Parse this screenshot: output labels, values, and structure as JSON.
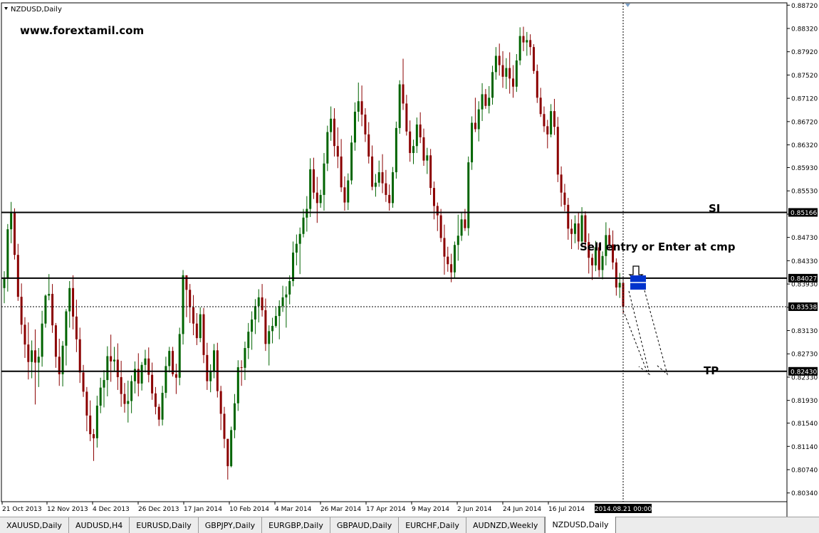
{
  "window": {
    "menu_icon": "dropdown-triangle-icon",
    "title": "NZDUSD,Daily"
  },
  "annotations": {
    "watermark": "www.forextamil.com",
    "sl_label": "SI",
    "sell_label": "Sell entry or Enter at cmp",
    "tp_label": "TP"
  },
  "chart_data": {
    "type": "candlestick",
    "symbol": "NZDUSD",
    "timeframe": "Daily",
    "ylim": [
      0.8019,
      0.8876
    ],
    "y_ticks": [
      0.8872,
      0.8832,
      0.8792,
      0.8752,
      0.8712,
      0.8672,
      0.8632,
      0.8593,
      0.8553,
      0.8513,
      0.8473,
      0.8433,
      0.8393,
      0.8353,
      0.8313,
      0.8273,
      0.8233,
      0.8193,
      0.8154,
      0.8114,
      0.8074,
      0.8034
    ],
    "y_tick_labels": [
      "0.88720",
      "0.88320",
      "0.87920",
      "0.87520",
      "0.87120",
      "0.86720",
      "0.86320",
      "0.85930",
      "0.85530",
      "0.85130",
      "0.84730",
      "0.84330",
      "0.83930",
      "0.83530",
      "0.83130",
      "0.82730",
      "0.82330",
      "0.81930",
      "0.81540",
      "0.81140",
      "0.80740",
      "0.80340"
    ],
    "x_labels": [
      "21 Oct 2013",
      "12 Nov 2013",
      "4 Dec 2013",
      "26 Dec 2013",
      "17 Jan 2014",
      "10 Feb 2014",
      "4 Mar 2014",
      "26 Mar 2014",
      "17 Apr 2014",
      "9 May 2014",
      "2 Jun 2014",
      "24 Jun 2014",
      "16 Jul 2014"
    ],
    "crosshair_date": "2014.08.21 00:00",
    "levels": [
      {
        "name": "stop-loss",
        "price": 0.8516,
        "label": "0.85166"
      },
      {
        "name": "entry",
        "price": 0.8403,
        "label": "0.84027"
      },
      {
        "name": "current-price",
        "price": 0.8354,
        "label": "0.83538"
      },
      {
        "name": "take-profit",
        "price": 0.8243,
        "label": "0.82430"
      }
    ],
    "colors": {
      "bull": "#006400",
      "bear": "#8b0000",
      "level": "#000000",
      "marker": "#0033cc"
    },
    "candles_ohlc": [
      [
        0.8386,
        0.8415,
        0.836,
        0.8402
      ],
      [
        0.8402,
        0.8496,
        0.838,
        0.8487
      ],
      [
        0.8487,
        0.8534,
        0.8463,
        0.8516
      ],
      [
        0.8516,
        0.8523,
        0.8435,
        0.8443
      ],
      [
        0.8443,
        0.8462,
        0.8364,
        0.8371
      ],
      [
        0.8371,
        0.8394,
        0.8307,
        0.8323
      ],
      [
        0.8323,
        0.8336,
        0.8266,
        0.8289
      ],
      [
        0.8289,
        0.8327,
        0.8229,
        0.8259
      ],
      [
        0.8259,
        0.8296,
        0.8231,
        0.8279
      ],
      [
        0.8279,
        0.8315,
        0.8186,
        0.8258
      ],
      [
        0.8258,
        0.8283,
        0.8216,
        0.8268
      ],
      [
        0.8268,
        0.8347,
        0.8251,
        0.8325
      ],
      [
        0.8325,
        0.8375,
        0.8318,
        0.8373
      ],
      [
        0.8373,
        0.841,
        0.8365,
        0.8376
      ],
      [
        0.8376,
        0.8393,
        0.8309,
        0.8322
      ],
      [
        0.8322,
        0.8326,
        0.8249,
        0.8268
      ],
      [
        0.8268,
        0.8299,
        0.8218,
        0.8238
      ],
      [
        0.8238,
        0.8295,
        0.8217,
        0.8287
      ],
      [
        0.8287,
        0.835,
        0.8253,
        0.8346
      ],
      [
        0.8346,
        0.8398,
        0.8318,
        0.8386
      ],
      [
        0.8386,
        0.8408,
        0.8315,
        0.8337
      ],
      [
        0.8337,
        0.8366,
        0.8276,
        0.8298
      ],
      [
        0.8298,
        0.8318,
        0.8223,
        0.8241
      ],
      [
        0.8241,
        0.8254,
        0.8199,
        0.8208
      ],
      [
        0.8208,
        0.8216,
        0.814,
        0.8167
      ],
      [
        0.8167,
        0.8193,
        0.8123,
        0.8135
      ],
      [
        0.8135,
        0.8144,
        0.8089,
        0.8128
      ],
      [
        0.8128,
        0.8201,
        0.8112,
        0.8184
      ],
      [
        0.8184,
        0.8232,
        0.8171,
        0.8215
      ],
      [
        0.8215,
        0.8245,
        0.8181,
        0.8228
      ],
      [
        0.8228,
        0.8286,
        0.82,
        0.8269
      ],
      [
        0.8269,
        0.8306,
        0.8225,
        0.826
      ],
      [
        0.826,
        0.8285,
        0.8242,
        0.8263
      ],
      [
        0.8263,
        0.8291,
        0.8211,
        0.8233
      ],
      [
        0.8233,
        0.8261,
        0.8182,
        0.8204
      ],
      [
        0.8204,
        0.8223,
        0.8172,
        0.8187
      ],
      [
        0.8187,
        0.8227,
        0.8155,
        0.8192
      ],
      [
        0.8192,
        0.8236,
        0.8171,
        0.8226
      ],
      [
        0.8226,
        0.826,
        0.8205,
        0.8247
      ],
      [
        0.8247,
        0.8274,
        0.82,
        0.8222
      ],
      [
        0.8222,
        0.8259,
        0.821,
        0.8254
      ],
      [
        0.8254,
        0.828,
        0.8241,
        0.8265
      ],
      [
        0.8265,
        0.8284,
        0.8224,
        0.8237
      ],
      [
        0.8237,
        0.8258,
        0.8194,
        0.8205
      ],
      [
        0.8205,
        0.8216,
        0.8169,
        0.8182
      ],
      [
        0.8182,
        0.8187,
        0.8149,
        0.816
      ],
      [
        0.816,
        0.8218,
        0.815,
        0.8206
      ],
      [
        0.8206,
        0.8268,
        0.8197,
        0.8252
      ],
      [
        0.8252,
        0.8285,
        0.8241,
        0.8278
      ],
      [
        0.8278,
        0.8285,
        0.8234,
        0.8238
      ],
      [
        0.8238,
        0.8256,
        0.8204,
        0.8232
      ],
      [
        0.8232,
        0.8318,
        0.8219,
        0.8307
      ],
      [
        0.8307,
        0.8417,
        0.8289,
        0.8408
      ],
      [
        0.8408,
        0.8401,
        0.8336,
        0.8383
      ],
      [
        0.8383,
        0.8393,
        0.8326,
        0.8353
      ],
      [
        0.8353,
        0.8374,
        0.8305,
        0.8325
      ],
      [
        0.8325,
        0.8343,
        0.8288,
        0.83
      ],
      [
        0.83,
        0.8353,
        0.8293,
        0.8341
      ],
      [
        0.8341,
        0.8352,
        0.8257,
        0.8271
      ],
      [
        0.8271,
        0.8292,
        0.8211,
        0.8226
      ],
      [
        0.8226,
        0.8255,
        0.8207,
        0.8243
      ],
      [
        0.8243,
        0.829,
        0.8231,
        0.8279
      ],
      [
        0.8279,
        0.8292,
        0.8198,
        0.8209
      ],
      [
        0.8209,
        0.8218,
        0.8142,
        0.817
      ],
      [
        0.817,
        0.8182,
        0.8111,
        0.8127
      ],
      [
        0.8127,
        0.8121,
        0.8057,
        0.808
      ],
      [
        0.808,
        0.8148,
        0.8078,
        0.8142
      ],
      [
        0.8142,
        0.8204,
        0.8128,
        0.8188
      ],
      [
        0.8188,
        0.8262,
        0.8175,
        0.825
      ],
      [
        0.825,
        0.8262,
        0.8218,
        0.8249
      ],
      [
        0.8249,
        0.8294,
        0.8228,
        0.8283
      ],
      [
        0.8283,
        0.8326,
        0.8264,
        0.8311
      ],
      [
        0.8311,
        0.8346,
        0.828,
        0.8332
      ],
      [
        0.8332,
        0.8367,
        0.8307,
        0.8355
      ],
      [
        0.8355,
        0.8384,
        0.8327,
        0.837
      ],
      [
        0.837,
        0.8393,
        0.8337,
        0.8348
      ],
      [
        0.8348,
        0.8368,
        0.8278,
        0.829
      ],
      [
        0.829,
        0.8322,
        0.8253,
        0.8312
      ],
      [
        0.8312,
        0.8335,
        0.8291,
        0.8321
      ],
      [
        0.8321,
        0.8353,
        0.8318,
        0.8338
      ],
      [
        0.8338,
        0.8365,
        0.8298,
        0.8355
      ],
      [
        0.8355,
        0.839,
        0.8345,
        0.837
      ],
      [
        0.837,
        0.8389,
        0.8318,
        0.8375
      ],
      [
        0.8375,
        0.8408,
        0.8358,
        0.8398
      ],
      [
        0.8398,
        0.8466,
        0.8389,
        0.8447
      ],
      [
        0.8447,
        0.8478,
        0.8425,
        0.8462
      ],
      [
        0.8462,
        0.849,
        0.841,
        0.8479
      ],
      [
        0.8479,
        0.8522,
        0.8473,
        0.8507
      ],
      [
        0.8507,
        0.8544,
        0.8483,
        0.8522
      ],
      [
        0.8522,
        0.8609,
        0.8508,
        0.859
      ],
      [
        0.859,
        0.861,
        0.8539,
        0.855
      ],
      [
        0.855,
        0.8577,
        0.8498,
        0.8532
      ],
      [
        0.8532,
        0.8555,
        0.8524,
        0.8546
      ],
      [
        0.8546,
        0.8618,
        0.8519,
        0.86
      ],
      [
        0.86,
        0.8665,
        0.8587,
        0.8654
      ],
      [
        0.8654,
        0.8698,
        0.8639,
        0.8677
      ],
      [
        0.8677,
        0.8695,
        0.8612,
        0.863
      ],
      [
        0.863,
        0.8662,
        0.8592,
        0.8612
      ],
      [
        0.8612,
        0.8642,
        0.8551,
        0.8559
      ],
      [
        0.8559,
        0.8578,
        0.8519,
        0.8533
      ],
      [
        0.8533,
        0.8583,
        0.852,
        0.8571
      ],
      [
        0.8571,
        0.8648,
        0.8564,
        0.8636
      ],
      [
        0.8636,
        0.8705,
        0.8622,
        0.8689
      ],
      [
        0.8689,
        0.8739,
        0.8672,
        0.8707
      ],
      [
        0.8707,
        0.8734,
        0.8664,
        0.8684
      ],
      [
        0.8684,
        0.8695,
        0.8637,
        0.865
      ],
      [
        0.865,
        0.8671,
        0.86,
        0.8612
      ],
      [
        0.8612,
        0.8631,
        0.8554,
        0.856
      ],
      [
        0.856,
        0.8582,
        0.8543,
        0.8567
      ],
      [
        0.8567,
        0.8605,
        0.856,
        0.8585
      ],
      [
        0.8585,
        0.8616,
        0.8549,
        0.8566
      ],
      [
        0.8566,
        0.8589,
        0.8534,
        0.8546
      ],
      [
        0.8546,
        0.8564,
        0.8519,
        0.8532
      ],
      [
        0.8532,
        0.8594,
        0.8524,
        0.8585
      ],
      [
        0.8585,
        0.8672,
        0.8574,
        0.8661
      ],
      [
        0.8661,
        0.8743,
        0.8651,
        0.8736
      ],
      [
        0.8736,
        0.878,
        0.8692,
        0.8703
      ],
      [
        0.8703,
        0.8718,
        0.8648,
        0.8655
      ],
      [
        0.8655,
        0.8674,
        0.8603,
        0.8618
      ],
      [
        0.8618,
        0.8641,
        0.8599,
        0.863
      ],
      [
        0.863,
        0.8679,
        0.8618,
        0.8667
      ],
      [
        0.8667,
        0.8688,
        0.8635,
        0.8645
      ],
      [
        0.8645,
        0.866,
        0.8596,
        0.8605
      ],
      [
        0.8605,
        0.8627,
        0.8582,
        0.8614
      ],
      [
        0.8614,
        0.8625,
        0.8546,
        0.8558
      ],
      [
        0.8558,
        0.8569,
        0.8504,
        0.8527
      ],
      [
        0.8527,
        0.8533,
        0.8484,
        0.8511
      ],
      [
        0.8511,
        0.8522,
        0.8465,
        0.8472
      ],
      [
        0.8472,
        0.8495,
        0.8409,
        0.844
      ],
      [
        0.844,
        0.8457,
        0.8414,
        0.8427
      ],
      [
        0.8427,
        0.8445,
        0.8396,
        0.8413
      ],
      [
        0.8413,
        0.8466,
        0.8403,
        0.846
      ],
      [
        0.846,
        0.8512,
        0.8433,
        0.8476
      ],
      [
        0.8476,
        0.8516,
        0.8467,
        0.8504
      ],
      [
        0.8504,
        0.8522,
        0.8484,
        0.8489
      ],
      [
        0.8489,
        0.8612,
        0.8476,
        0.8602
      ],
      [
        0.8602,
        0.8681,
        0.8589,
        0.867
      ],
      [
        0.867,
        0.8713,
        0.8654,
        0.8659
      ],
      [
        0.8659,
        0.8707,
        0.8638,
        0.8693
      ],
      [
        0.8693,
        0.8738,
        0.8673,
        0.8719
      ],
      [
        0.8719,
        0.8728,
        0.8694,
        0.8699
      ],
      [
        0.8699,
        0.8733,
        0.8686,
        0.8713
      ],
      [
        0.8713,
        0.8768,
        0.8701,
        0.8757
      ],
      [
        0.8757,
        0.88,
        0.8744,
        0.8785
      ],
      [
        0.8785,
        0.8806,
        0.8751,
        0.8769
      ],
      [
        0.8769,
        0.8793,
        0.873,
        0.8749
      ],
      [
        0.8749,
        0.8781,
        0.8728,
        0.8764
      ],
      [
        0.8764,
        0.8791,
        0.872,
        0.8746
      ],
      [
        0.8746,
        0.8769,
        0.8713,
        0.8732
      ],
      [
        0.8732,
        0.8788,
        0.8723,
        0.8777
      ],
      [
        0.8777,
        0.8834,
        0.8769,
        0.8819
      ],
      [
        0.8819,
        0.8835,
        0.8793,
        0.8808
      ],
      [
        0.8808,
        0.8826,
        0.8785,
        0.8812
      ],
      [
        0.8812,
        0.8822,
        0.8786,
        0.88
      ],
      [
        0.88,
        0.8805,
        0.8754,
        0.8759
      ],
      [
        0.8759,
        0.877,
        0.8704,
        0.8713
      ],
      [
        0.8713,
        0.873,
        0.868,
        0.8685
      ],
      [
        0.8685,
        0.8698,
        0.8654,
        0.8664
      ],
      [
        0.8664,
        0.8675,
        0.8626,
        0.865
      ],
      [
        0.865,
        0.8702,
        0.8645,
        0.869
      ],
      [
        0.869,
        0.8711,
        0.8649,
        0.8663
      ],
      [
        0.8663,
        0.868,
        0.8568,
        0.8581
      ],
      [
        0.8581,
        0.8595,
        0.8526,
        0.855
      ],
      [
        0.855,
        0.8565,
        0.8518,
        0.8529
      ],
      [
        0.8529,
        0.8541,
        0.8469,
        0.8488
      ],
      [
        0.8488,
        0.8504,
        0.8453,
        0.8479
      ],
      [
        0.8479,
        0.8511,
        0.8463,
        0.8497
      ],
      [
        0.8497,
        0.8516,
        0.8452,
        0.8466
      ],
      [
        0.8466,
        0.8525,
        0.8456,
        0.8511
      ],
      [
        0.8511,
        0.8518,
        0.8453,
        0.8465
      ],
      [
        0.8465,
        0.848,
        0.8411,
        0.8438
      ],
      [
        0.8438,
        0.8445,
        0.84,
        0.8425
      ],
      [
        0.8425,
        0.8467,
        0.8415,
        0.8456
      ],
      [
        0.8456,
        0.8463,
        0.8405,
        0.8417
      ],
      [
        0.8417,
        0.8449,
        0.8401,
        0.8441
      ],
      [
        0.8441,
        0.8499,
        0.8425,
        0.8477
      ],
      [
        0.8477,
        0.8489,
        0.8453,
        0.8461
      ],
      [
        0.8461,
        0.8485,
        0.8418,
        0.843
      ],
      [
        0.843,
        0.8437,
        0.8373,
        0.8387
      ],
      [
        0.8387,
        0.8412,
        0.8369,
        0.8395
      ],
      [
        0.8395,
        0.84,
        0.8341,
        0.8354
      ]
    ]
  },
  "tabs": [
    {
      "label": "XAUUSD,Daily"
    },
    {
      "label": "AUDUSD,H4"
    },
    {
      "label": "EURUSD,Daily"
    },
    {
      "label": "GBPJPY,Daily"
    },
    {
      "label": "EURGBP,Daily"
    },
    {
      "label": "GBPAUD,Daily"
    },
    {
      "label": "EURCHF,Daily"
    },
    {
      "label": "AUDNZD,Weekly"
    },
    {
      "label": "NZDUSD,Daily",
      "active": true
    }
  ]
}
